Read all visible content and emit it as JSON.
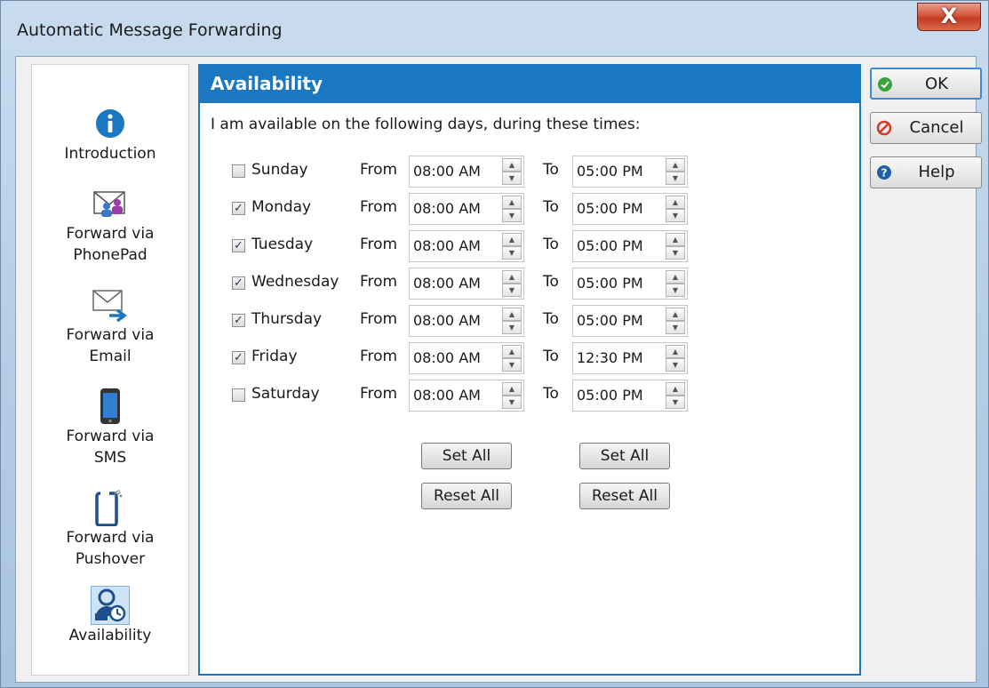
{
  "window": {
    "title": "Automatic Message Forwarding",
    "close_label": "X"
  },
  "nav": {
    "items": [
      {
        "label_1": "Introduction",
        "label_2": "",
        "icon": "info-icon"
      },
      {
        "label_1": "Forward via",
        "label_2": "PhonePad",
        "icon": "phonepad-icon"
      },
      {
        "label_1": "Forward via",
        "label_2": "Email",
        "icon": "email-forward-icon"
      },
      {
        "label_1": "Forward via",
        "label_2": "SMS",
        "icon": "mobile-phone-icon"
      },
      {
        "label_1": "Forward via",
        "label_2": "Pushover",
        "icon": "pushover-phone-icon"
      },
      {
        "label_1": "Availability",
        "label_2": "",
        "icon": "user-clock-icon",
        "selected": true
      }
    ]
  },
  "panel": {
    "header": "Availability",
    "intro": "I am available on the following days, during these times:",
    "from_label": "From",
    "to_label": "To",
    "days": [
      {
        "name": "Sunday",
        "checked": false,
        "from": "08:00 AM",
        "to": "05:00 PM"
      },
      {
        "name": "Monday",
        "checked": true,
        "from": "08:00 AM",
        "to": "05:00 PM"
      },
      {
        "name": "Tuesday",
        "checked": true,
        "from": "08:00 AM",
        "to": "05:00 PM"
      },
      {
        "name": "Wednesday",
        "checked": true,
        "from": "08:00 AM",
        "to": "05:00 PM"
      },
      {
        "name": "Thursday",
        "checked": true,
        "from": "08:00 AM",
        "to": "05:00 PM"
      },
      {
        "name": "Friday",
        "checked": true,
        "from": "08:00 AM",
        "to": "12:30 PM"
      },
      {
        "name": "Saturday",
        "checked": false,
        "from": "08:00 AM",
        "to": "05:00 PM"
      }
    ],
    "from_set_all": "Set All",
    "from_reset_all": "Reset All",
    "to_set_all": "Set All",
    "to_reset_all": "Reset All"
  },
  "buttons": {
    "ok": "OK",
    "cancel": "Cancel",
    "help": "Help"
  },
  "colors": {
    "accent": "#1a78c2",
    "ok_green": "#3aa33a",
    "cancel_red": "#d23a2a",
    "help_blue": "#1f5ea8"
  }
}
